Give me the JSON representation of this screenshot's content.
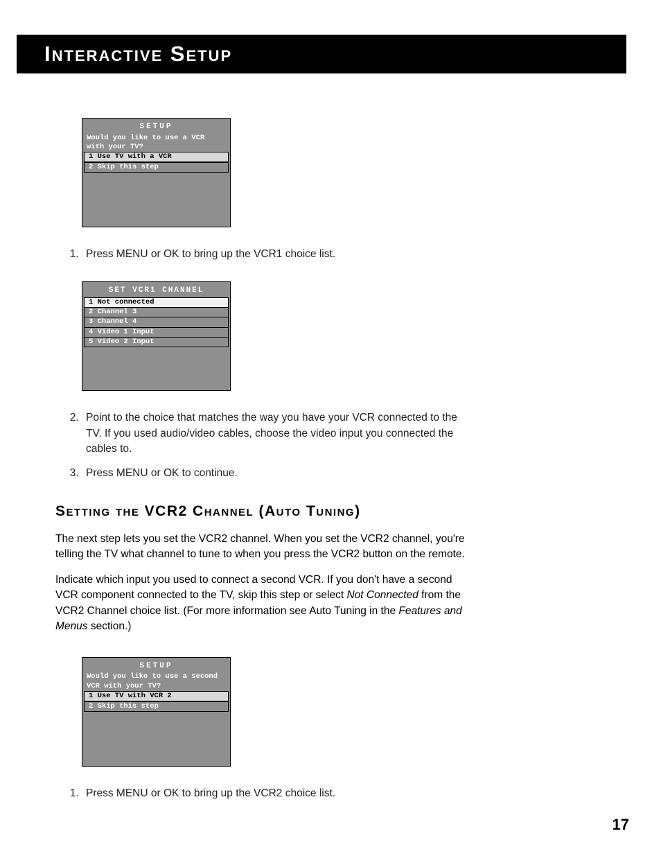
{
  "header": {
    "title": "Interactive Setup"
  },
  "osd1": {
    "title": "SETUP",
    "prompt_line1": "Would you like to use a VCR",
    "prompt_line2": "with your TV?",
    "opt1": "1 Use TV with a VCR",
    "opt2": "2 Skip this step"
  },
  "steps_a": {
    "s1": "Press MENU or OK to bring up the VCR1 choice list."
  },
  "osd2": {
    "title": "SET VCR1 CHANNEL",
    "opt1": "1 Not connected",
    "opt2": "2 Channel 3",
    "opt3": "3 Channel 4",
    "opt4": "4 Video 1 Input",
    "opt5": "5 Video 2 Input"
  },
  "steps_b": {
    "s2": "Point to the choice that matches the way you have your VCR connected to the TV. If you used audio/video cables, choose the video input you connected the cables to.",
    "s3": "Press MENU or OK to continue."
  },
  "section2": {
    "heading": "Setting the VCR2 Channel (Auto Tuning)",
    "p1": "The next step lets you set the VCR2 channel. When you set the VCR2 channel, you're telling the TV what channel to tune to when you press the VCR2 button on the remote.",
    "p2a": "Indicate which input you used to connect a second VCR.  If you don't have a second VCR component connected to the TV, skip this step or select ",
    "p2_em1": "Not Connected",
    "p2b": " from the VCR2 Channel choice list. (For more information see Auto Tuning in the ",
    "p2_em2": "Features and Menus",
    "p2c": " section.)"
  },
  "osd3": {
    "title": "SETUP",
    "prompt_line1": "Would you like to use a second",
    "prompt_line2": "VCR with your TV?",
    "opt1": "1 Use TV with VCR 2",
    "opt2": "2 Skip this step"
  },
  "steps_c": {
    "s1": "Press MENU or OK to bring up the VCR2 choice list."
  },
  "page_number": "17"
}
